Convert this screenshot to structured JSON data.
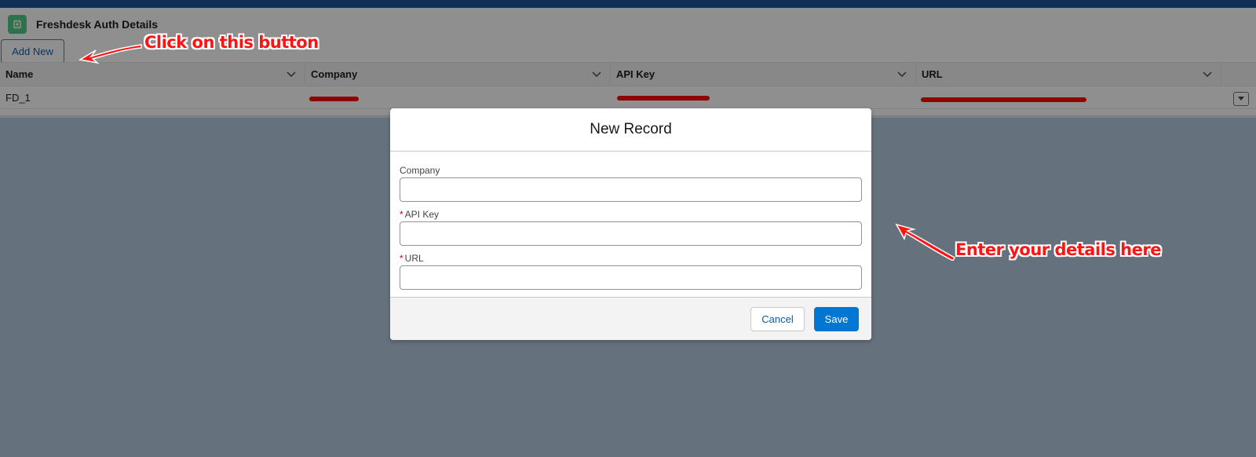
{
  "card": {
    "title": "Freshdesk Auth Details",
    "add_new_label": "Add New"
  },
  "table": {
    "columns": [
      "Name",
      "Company",
      "API Key",
      "URL"
    ],
    "rows": [
      {
        "name": "FD_1",
        "company": "",
        "api_key": "",
        "url": ""
      }
    ]
  },
  "modal": {
    "title": "New Record",
    "fields": [
      {
        "label": "Company",
        "required": false,
        "value": ""
      },
      {
        "label": "API Key",
        "required": true,
        "value": ""
      },
      {
        "label": "URL",
        "required": true,
        "value": ""
      }
    ],
    "required_marker": "*",
    "cancel_label": "Cancel",
    "save_label": "Save"
  },
  "annotations": {
    "click_text": "Click on this button",
    "enter_text": "Enter your details here"
  },
  "colors": {
    "brand": "#0176d3",
    "annotation": "#ff1414",
    "app_icon": "#4bca81"
  },
  "icons": {
    "app": "app-icon",
    "column_menu": "chevron-down-icon",
    "row_action": "caret-down-icon"
  }
}
